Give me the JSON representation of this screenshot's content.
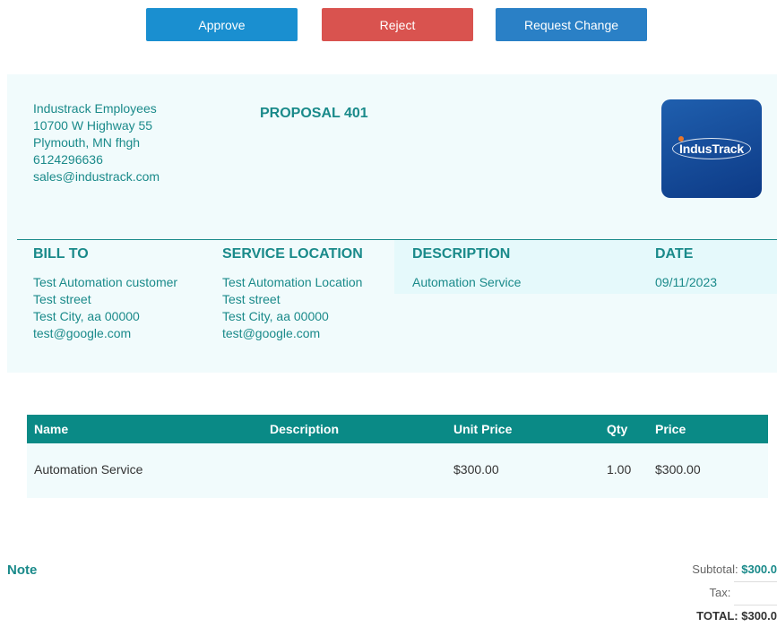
{
  "actions": {
    "approve_label": "Approve",
    "reject_label": "Reject",
    "request_change_label": "Request Change"
  },
  "company": {
    "name": "Industrack Employees",
    "address_line1": "10700 W Highway 55",
    "address_line2": "Plymouth, MN fhgh",
    "phone": "6124296636",
    "email": "sales@industrack.com",
    "logo_text": "IndusTrack"
  },
  "proposal": {
    "title": "PROPOSAL 401"
  },
  "bill_to": {
    "heading": "BILL TO",
    "name": "Test Automation customer",
    "street": "Test street",
    "city": "Test City, aa 00000",
    "email": "test@google.com"
  },
  "service_location": {
    "heading": "SERVICE LOCATION",
    "name": "Test Automation Location",
    "street": "Test street",
    "city": "Test City, aa 00000",
    "email": "test@google.com"
  },
  "description": {
    "heading": "DESCRIPTION",
    "value": "Automation Service"
  },
  "date": {
    "heading": "DATE",
    "value": "09/11/2023"
  },
  "items_table": {
    "columns": [
      "Name",
      "Description",
      "Unit Price",
      "Qty",
      "Price"
    ],
    "rows": [
      {
        "name": "Automation Service",
        "description": "",
        "unit_price": "$300.00",
        "qty": "1.00",
        "price": "$300.00"
      }
    ]
  },
  "note": {
    "label": "Note"
  },
  "totals": {
    "subtotal_label": "Subtotal:",
    "subtotal_value": "$300.0",
    "tax_label": "Tax:",
    "tax_value": "",
    "total_label": "TOTAL:",
    "total_value": "$300.0"
  },
  "colors": {
    "teal": "#1a8a8a",
    "table_header": "#0a8a86",
    "approve": "#1a8fd0",
    "reject": "#d9534f",
    "request_change": "#2a80c6",
    "card_bg": "#f1fbfc"
  }
}
